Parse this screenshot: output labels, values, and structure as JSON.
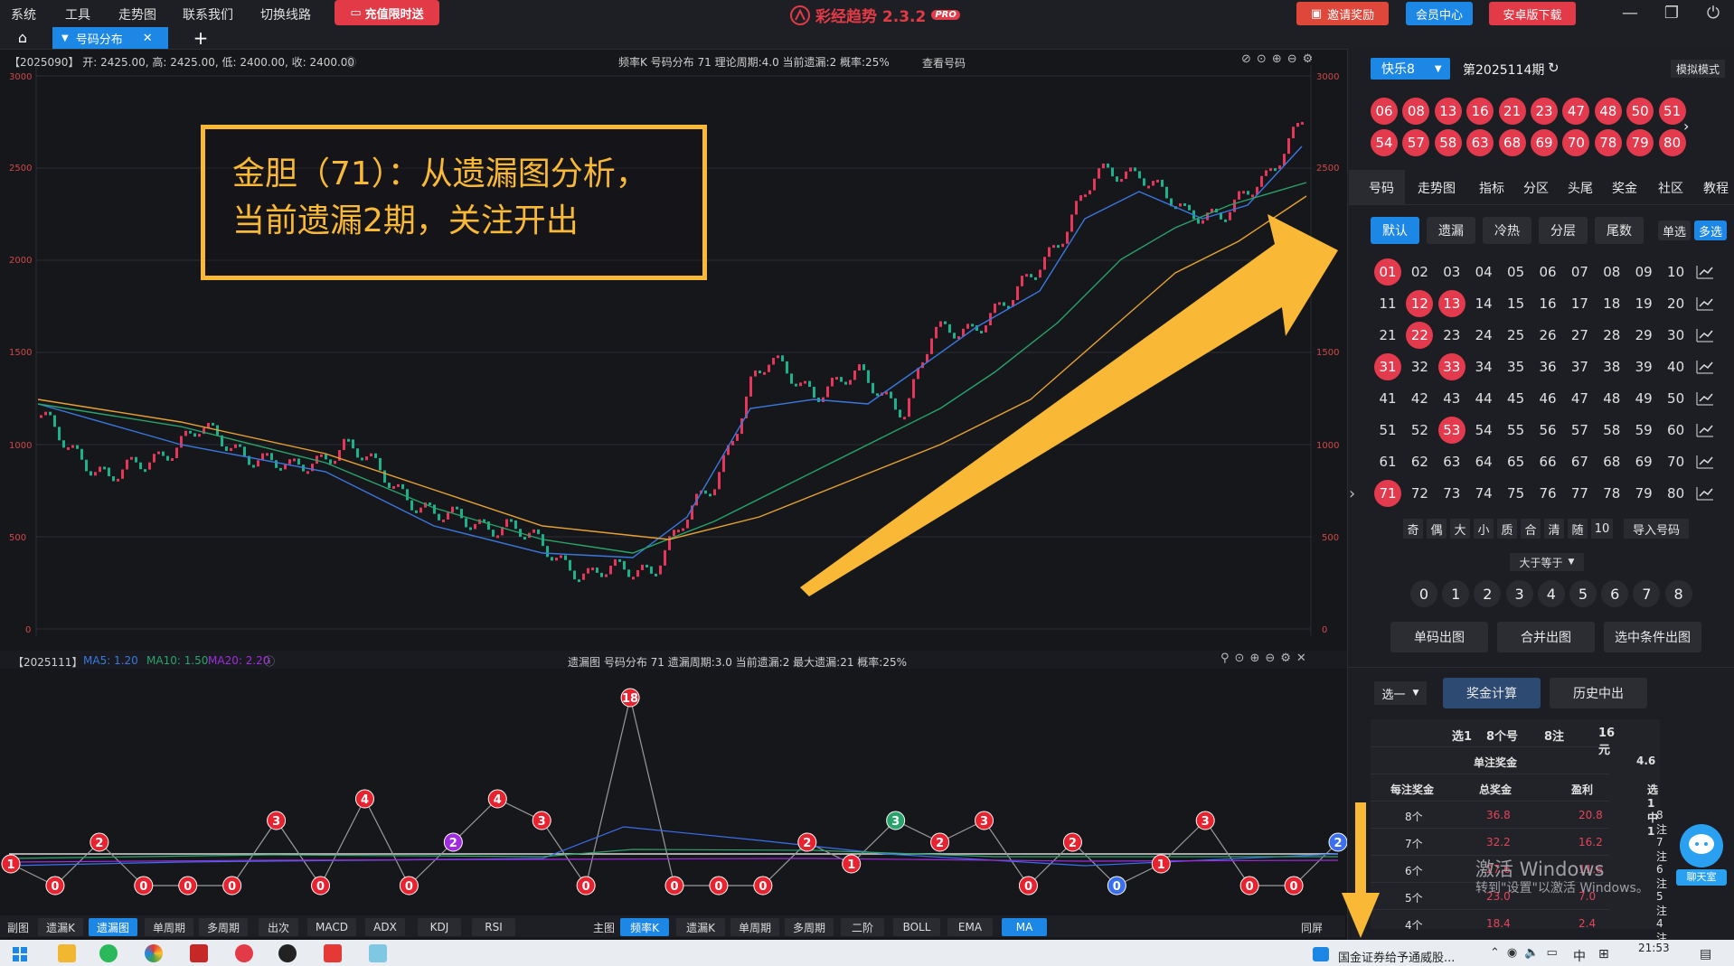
{
  "menu": {
    "items": [
      "系统",
      "工具",
      "走势图",
      "联系我们",
      "切换线路"
    ],
    "recharge_label": "充值限时送",
    "app_title": "彩经趋势 2.3.2",
    "app_badge": "PRO",
    "invite_label": "邀请奖励",
    "member_label": "会员中心",
    "android_label": "安卓版下载"
  },
  "tabs": {
    "active_label": "号码分布"
  },
  "top_chart": {
    "info_left": "【2025090】 开: 2425.00, 高: 2425.00, 低: 2400.00, 收: 2400.00",
    "info_center": "频率K  号码分布  71    理论周期:4.0  当前遗漏:2  概率:25%",
    "view_numbers": "查看号码",
    "y_ticks": [
      "3000",
      "2500",
      "2000",
      "1500",
      "1000",
      "500",
      "0"
    ],
    "annotation_line1": "金胆（71）：从遗漏图分析，",
    "annotation_line2": "当前遗漏2期，关注开出"
  },
  "bottom_chart": {
    "info_left": "【2025111】",
    "ma5": "MA5: 1.20",
    "ma10": "MA10: 1.50",
    "ma20": "MA20: 2.20",
    "info_center": "遗漏图  号码分布  71    遗漏周期:3.0  当前遗漏:2  最大遗漏:21  概率:25%",
    "points": [
      {
        "v": "1",
        "c": "#e8232f"
      },
      {
        "v": "0",
        "c": "#e8232f"
      },
      {
        "v": "2",
        "c": "#e8232f"
      },
      {
        "v": "0",
        "c": "#e8232f"
      },
      {
        "v": "0",
        "c": "#e8232f"
      },
      {
        "v": "0",
        "c": "#e8232f"
      },
      {
        "v": "3",
        "c": "#e8232f"
      },
      {
        "v": "0",
        "c": "#e8232f"
      },
      {
        "v": "4",
        "c": "#e8232f"
      },
      {
        "v": "0",
        "c": "#e8232f"
      },
      {
        "v": "2",
        "c": "#a12be0"
      },
      {
        "v": "4",
        "c": "#e8232f"
      },
      {
        "v": "3",
        "c": "#e8232f"
      },
      {
        "v": "0",
        "c": "#e8232f"
      },
      {
        "v": "18",
        "c": "#e8232f"
      },
      {
        "v": "0",
        "c": "#e8232f"
      },
      {
        "v": "0",
        "c": "#e8232f"
      },
      {
        "v": "0",
        "c": "#e8232f"
      },
      {
        "v": "2",
        "c": "#e8232f"
      },
      {
        "v": "1",
        "c": "#e8232f"
      },
      {
        "v": "3",
        "c": "#2aa36b"
      },
      {
        "v": "2",
        "c": "#e8232f"
      },
      {
        "v": "3",
        "c": "#e8232f"
      },
      {
        "v": "0",
        "c": "#e8232f"
      },
      {
        "v": "2",
        "c": "#e8232f"
      },
      {
        "v": "0",
        "c": "#3a6ff0"
      },
      {
        "v": "1",
        "c": "#e8232f"
      },
      {
        "v": "3",
        "c": "#e8232f"
      },
      {
        "v": "0",
        "c": "#e8232f"
      },
      {
        "v": "0",
        "c": "#e8232f"
      },
      {
        "v": "2",
        "c": "#3a6ff0"
      }
    ]
  },
  "toolbar": {
    "sub_label": "副图",
    "sub_buttons": [
      "遗漏K",
      "遗漏图",
      "单周期",
      "多周期",
      "出次",
      "MACD",
      "ADX",
      "KDJ",
      "RSI"
    ],
    "sub_active": "遗漏图",
    "main_label": "主图",
    "main_buttons": [
      "频率K",
      "遗漏K",
      "单周期",
      "多周期",
      "二阶",
      "BOLL",
      "EMA",
      "MA"
    ],
    "main_active_1": "频率K",
    "main_active_2": "MA",
    "sync_label": "同屏"
  },
  "right_panel": {
    "game_select": "快乐8",
    "period": "第2025114期",
    "mock_mode": "模拟模式",
    "draw_numbers": [
      "06",
      "08",
      "13",
      "16",
      "21",
      "23",
      "47",
      "48",
      "50",
      "51",
      "54",
      "57",
      "58",
      "63",
      "68",
      "69",
      "70",
      "78",
      "79",
      "80"
    ],
    "tabs": [
      "号码",
      "走势图",
      "指标",
      "分区",
      "头尾",
      "奖金",
      "社区",
      "教程"
    ],
    "segments": [
      "默认",
      "遗漏",
      "冷热",
      "分层",
      "尾数"
    ],
    "single_label": "单选",
    "multi_label": "多选",
    "selected_numbers": [
      "01",
      "12",
      "13",
      "22",
      "31",
      "33",
      "53",
      "71"
    ],
    "filters": [
      "奇",
      "偶",
      "大",
      "小",
      "质",
      "合",
      "清",
      "随",
      "10",
      "导入号码"
    ],
    "gte_label": "大于等于",
    "digits": [
      "0",
      "1",
      "2",
      "3",
      "4",
      "5",
      "6",
      "7",
      "8"
    ],
    "chart_buttons": [
      "单码出图",
      "合并出图",
      "选中条件出图"
    ],
    "pick_select": "选一",
    "calc_label": "奖金计算",
    "history_label": "历史中出",
    "summary": {
      "pick": "选1",
      "count": "8个号",
      "bets": "8注",
      "cost": "16元"
    },
    "single_prize_label": "单注奖金",
    "single_prize_value": "4.6",
    "table_headers": [
      "每注奖金",
      "总奖金",
      "盈利",
      "选1中1"
    ],
    "table_rows": [
      [
        "8个",
        "36.8",
        "20.8",
        "8注"
      ],
      [
        "7个",
        "32.2",
        "16.2",
        "7注"
      ],
      [
        "6个",
        "27.6",
        "11.6",
        "6注"
      ],
      [
        "5个",
        "23.0",
        "7.0",
        "5注"
      ],
      [
        "4个",
        "18.4",
        "2.4",
        "4注"
      ]
    ],
    "chat_label": "聊天室"
  },
  "windows": {
    "activate_title": "激活 Windows",
    "activate_sub": "转到\"设置\"以激活 Windows。"
  },
  "taskbar": {
    "news": "国金证券给予通威股...",
    "ime": "中",
    "time": "21:53"
  }
}
